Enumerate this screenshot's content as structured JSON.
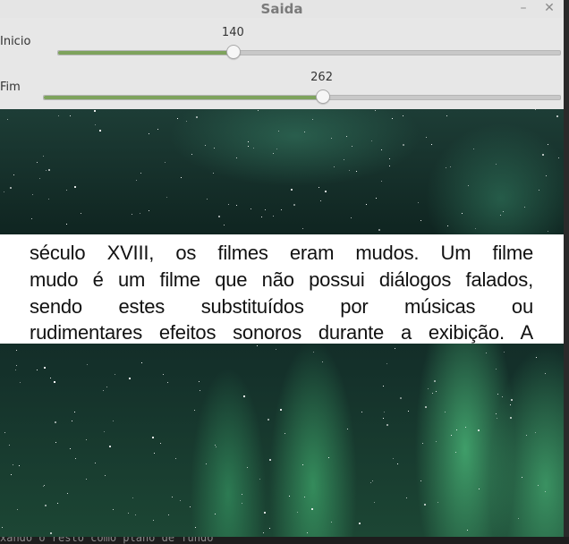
{
  "window": {
    "title": "Saida",
    "minimize_glyph": "–",
    "close_glyph": "✕"
  },
  "controls": {
    "start": {
      "label": "Inicio",
      "value": "140",
      "fraction": 0.35
    },
    "end": {
      "label": "Fim",
      "value": "262",
      "fraction": 0.54
    }
  },
  "video": {
    "text_lines": [
      "",
      "século XVIII, os filmes eram mudos. Um filme",
      "mudo é um filme que não possui diálogos falados,",
      "sendo estes substituídos por músicas ou",
      "rudimentares efeitos sonoros durante a exibição. A"
    ]
  },
  "terminal": {
    "partial_text": "xando o resto como plano de fundo"
  },
  "colors": {
    "slider_fill": "#7ea35d",
    "aurora": "#3fae74"
  }
}
